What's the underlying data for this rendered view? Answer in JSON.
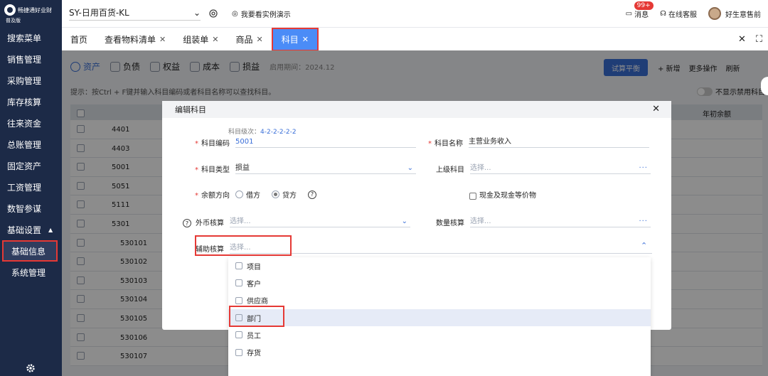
{
  "sidebar": {
    "logo_text": "畅捷通好业财",
    "edition": "普及版",
    "items": [
      {
        "label": "搜索菜单"
      },
      {
        "label": "销售管理"
      },
      {
        "label": "采购管理"
      },
      {
        "label": "库存核算"
      },
      {
        "label": "往来资金"
      },
      {
        "label": "总账管理"
      },
      {
        "label": "固定资产"
      },
      {
        "label": "工资管理"
      },
      {
        "label": "数智参谋"
      },
      {
        "label": "基础设置"
      },
      {
        "label": "基础信息"
      },
      {
        "label": "系统管理"
      }
    ]
  },
  "topbar": {
    "company": "SY-日用百货-KL",
    "demo": "我要看实例演示",
    "messages": "消息",
    "badge": "99+",
    "service": "在线客服",
    "user": "好生意售前"
  },
  "tabs": [
    {
      "label": "首页"
    },
    {
      "label": "查看物料清单"
    },
    {
      "label": "组装单"
    },
    {
      "label": "商品"
    },
    {
      "label": "科目"
    }
  ],
  "page": {
    "categories": [
      "资产",
      "负债",
      "权益",
      "成本",
      "损益"
    ],
    "period": "启用期间：2024.12",
    "trial_balance": "试算平衡",
    "add": "+ 新增",
    "more": "更多操作",
    "refresh": "刷新",
    "tip": "提示：按Ctrl + F键并输入科目编码或者科目名称可以查找科目。",
    "hide_disabled": "不显示禁用科目",
    "col_opening": "年初余额",
    "rows": [
      "4401",
      "4403",
      "5001",
      "5051",
      "5111",
      "5301",
      "530101",
      "530102",
      "530103",
      "530104",
      "530105",
      "530106",
      "530107"
    ]
  },
  "modal": {
    "title": "编辑科目",
    "level_label": "科目级次：",
    "level_value": "4-2-2-2-2-2",
    "code_label": "科目编码",
    "code_value": "5001",
    "name_label": "科目名称",
    "name_value": "主营业务收入",
    "type_label": "科目类型",
    "type_value": "损益",
    "parent_label": "上级科目",
    "parent_placeholder": "选择...",
    "direction_label": "余额方向",
    "debit": "借方",
    "credit": "贷方",
    "cash_label": "现金及现金等价物",
    "fx_label": "外币核算",
    "fx_placeholder": "选择...",
    "qty_label": "数量核算",
    "qty_placeholder": "选择...",
    "aux_label": "辅助核算",
    "aux_placeholder": "选择..."
  },
  "dropdown": {
    "options": [
      "项目",
      "客户",
      "供应商",
      "部门",
      "员工",
      "存货"
    ]
  }
}
